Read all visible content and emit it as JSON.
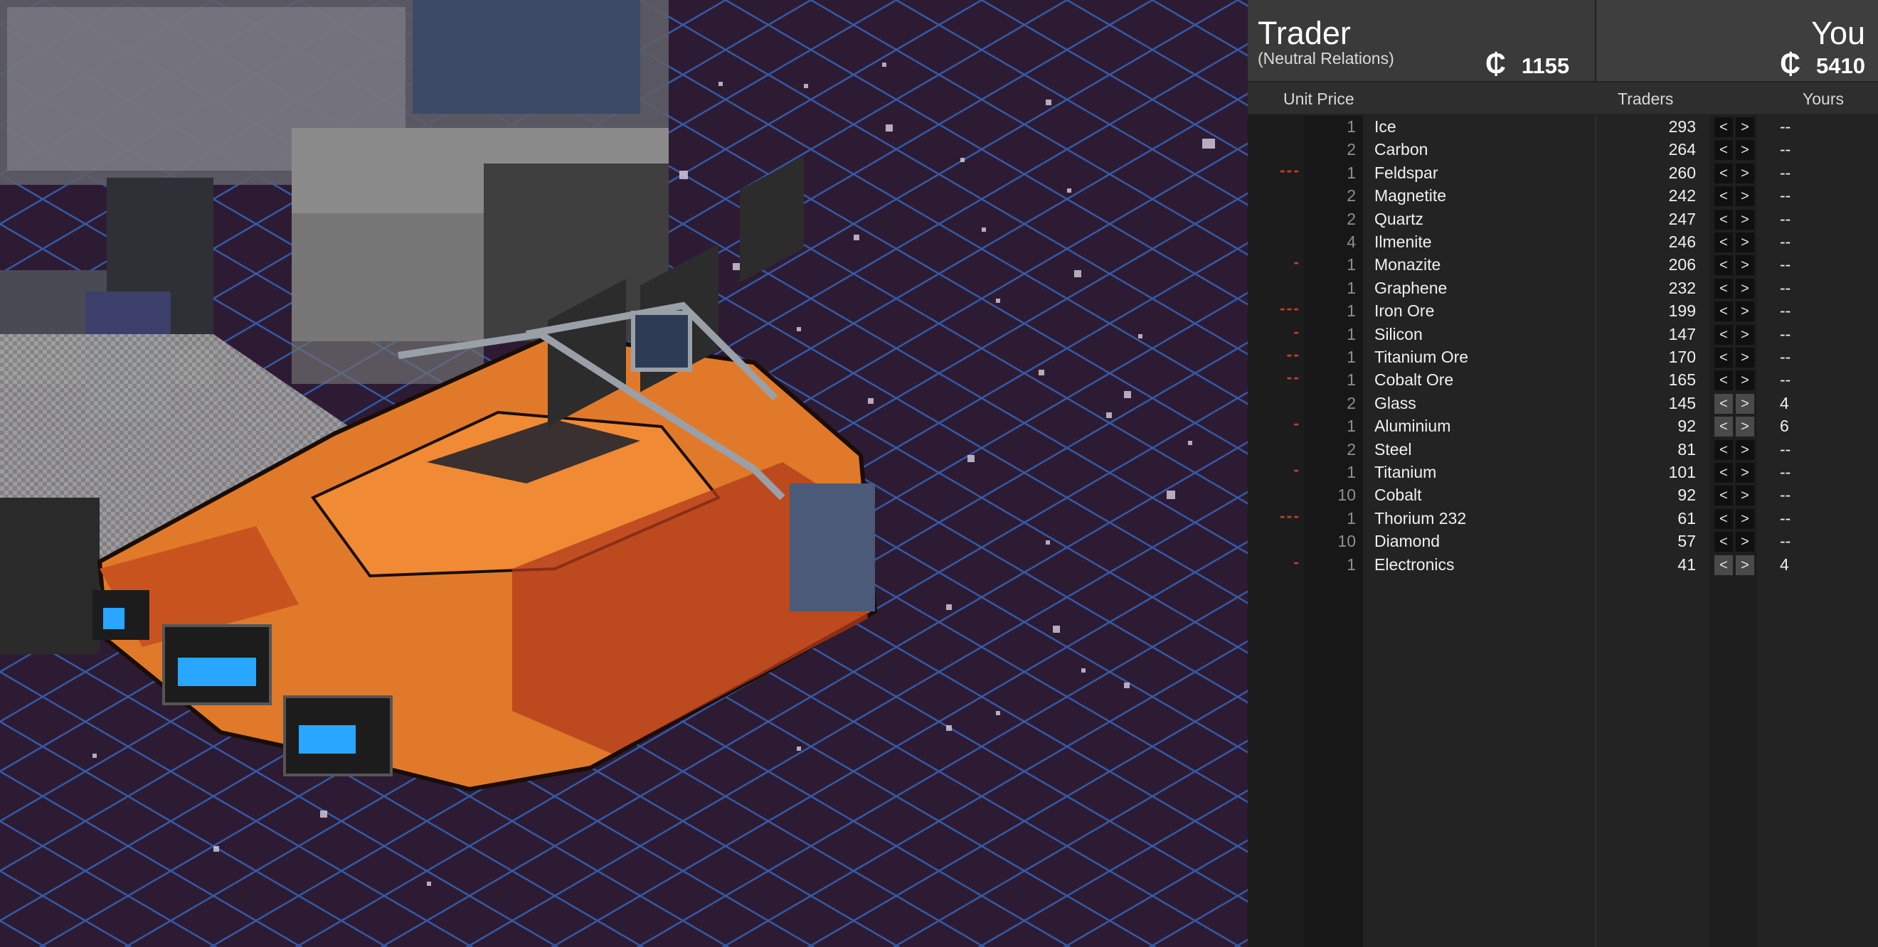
{
  "trader": {
    "title": "Trader",
    "relation": "(Neutral Relations)",
    "credit_symbol": "₵",
    "credits": "1155"
  },
  "player": {
    "title": "You",
    "credit_symbol": "₵",
    "credits": "5410"
  },
  "columns": {
    "unit_price": "Unit Price",
    "traders": "Traders",
    "yours": "Yours"
  },
  "buttons": {
    "decrease": "<",
    "increase": ">"
  },
  "items": [
    {
      "demand": "",
      "price": "1",
      "name": "Ice",
      "traders": "293",
      "yours": "--",
      "active": false
    },
    {
      "demand": "",
      "price": "2",
      "name": "Carbon",
      "traders": "264",
      "yours": "--",
      "active": false
    },
    {
      "demand": "---",
      "price": "1",
      "name": "Feldspar",
      "traders": "260",
      "yours": "--",
      "active": false
    },
    {
      "demand": "",
      "price": "2",
      "name": "Magnetite",
      "traders": "242",
      "yours": "--",
      "active": false
    },
    {
      "demand": "",
      "price": "2",
      "name": "Quartz",
      "traders": "247",
      "yours": "--",
      "active": false
    },
    {
      "demand": "",
      "price": "4",
      "name": "Ilmenite",
      "traders": "246",
      "yours": "--",
      "active": false
    },
    {
      "demand": "-",
      "price": "1",
      "name": "Monazite",
      "traders": "206",
      "yours": "--",
      "active": false
    },
    {
      "demand": "",
      "price": "1",
      "name": "Graphene",
      "traders": "232",
      "yours": "--",
      "active": false
    },
    {
      "demand": "---",
      "price": "1",
      "name": "Iron Ore",
      "traders": "199",
      "yours": "--",
      "active": false
    },
    {
      "demand": "-",
      "price": "1",
      "name": "Silicon",
      "traders": "147",
      "yours": "--",
      "active": false
    },
    {
      "demand": "--",
      "price": "1",
      "name": "Titanium Ore",
      "traders": "170",
      "yours": "--",
      "active": false
    },
    {
      "demand": "--",
      "price": "1",
      "name": "Cobalt Ore",
      "traders": "165",
      "yours": "--",
      "active": false
    },
    {
      "demand": "",
      "price": "2",
      "name": "Glass",
      "traders": "145",
      "yours": "4",
      "active": true
    },
    {
      "demand": "-",
      "price": "1",
      "name": "Aluminium",
      "traders": "92",
      "yours": "6",
      "active": true
    },
    {
      "demand": "",
      "price": "2",
      "name": "Steel",
      "traders": "81",
      "yours": "--",
      "active": false
    },
    {
      "demand": "-",
      "price": "1",
      "name": "Titanium",
      "traders": "101",
      "yours": "--",
      "active": false
    },
    {
      "demand": "",
      "price": "10",
      "name": "Cobalt",
      "traders": "92",
      "yours": "--",
      "active": false
    },
    {
      "demand": "---",
      "price": "1",
      "name": "Thorium 232",
      "traders": "61",
      "yours": "--",
      "active": false
    },
    {
      "demand": "",
      "price": "10",
      "name": "Diamond",
      "traders": "57",
      "yours": "--",
      "active": false
    },
    {
      "demand": "-",
      "price": "1",
      "name": "Electronics",
      "traders": "41",
      "yours": "4",
      "active": true
    }
  ],
  "colors": {
    "panel_bg": "#232323",
    "header_bg": "#3a3a3a",
    "demand_red": "#c83a2a",
    "space_bg": "#2a1a30",
    "grid_blue": "#2f5fb0",
    "ship_orange": "#e07a2a"
  }
}
